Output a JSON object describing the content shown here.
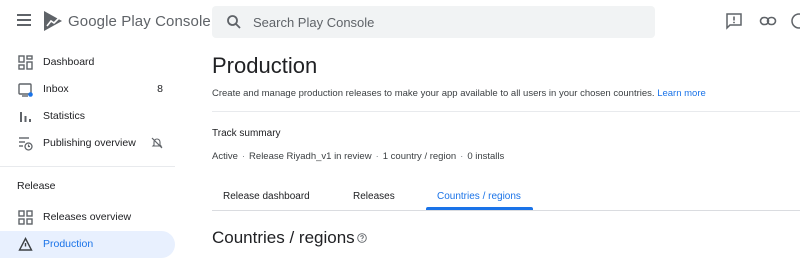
{
  "app": {
    "brand": "Google Play Console"
  },
  "search": {
    "placeholder": "Search Play Console"
  },
  "sidebar": {
    "items": [
      {
        "label": "Dashboard",
        "icon": "dashboard-icon"
      },
      {
        "label": "Inbox",
        "icon": "inbox-icon",
        "count": "8"
      },
      {
        "label": "Statistics",
        "icon": "bar-chart-icon"
      },
      {
        "label": "Publishing overview",
        "icon": "publishing-icon"
      }
    ],
    "section": "Release",
    "release_items": [
      {
        "label": "Releases overview",
        "icon": "grid-icon"
      },
      {
        "label": "Production",
        "icon": "warning-icon"
      }
    ]
  },
  "main": {
    "title": "Production",
    "description": "Create and manage production releases to make your app available to all users in your chosen countries.",
    "learn_more": "Learn more",
    "track_summary": {
      "title": "Track summary",
      "status": "Active",
      "release": "Release Riyadh_v1 in review",
      "countries": "1 country / region",
      "installs": "0 installs"
    },
    "tabs": [
      {
        "label": "Release dashboard"
      },
      {
        "label": "Releases"
      },
      {
        "label": "Countries / regions"
      }
    ],
    "section_title": "Countries / regions"
  },
  "colors": {
    "accent": "#1a73e8",
    "active_bg": "#e8f0fe",
    "text": "#202124",
    "muted": "#5f6368"
  }
}
